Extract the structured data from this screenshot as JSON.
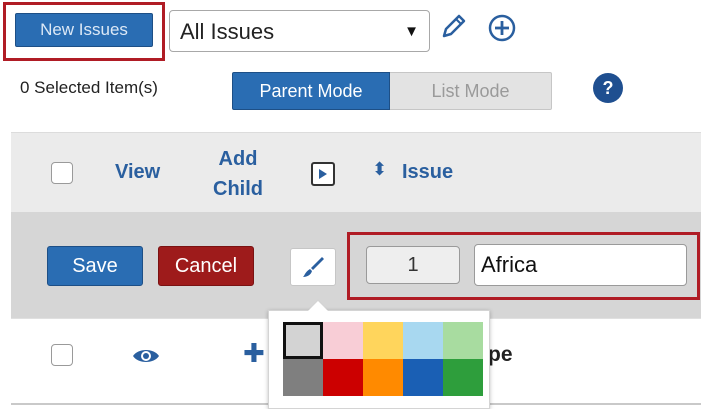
{
  "toolbar": {
    "new_issues_label": "New Issues",
    "view_select_value": "All Issues",
    "edit_icon": "pencil-icon",
    "add_icon": "plus-circle-icon"
  },
  "selection": {
    "count_text": "0  Selected Item(s)",
    "mode_active": "Parent Mode",
    "mode_inactive": "List Mode",
    "help_label": "?"
  },
  "table_header": {
    "view_label": "View",
    "add_child_line1": "Add",
    "add_child_line2": "Child",
    "issue_label": "Issue"
  },
  "edit_row": {
    "save_label": "Save",
    "cancel_label": "Cancel",
    "number_value": "1",
    "issue_name_value": "Africa"
  },
  "data_row": {
    "partial_text": "pe"
  },
  "palette": {
    "colors": [
      "#d3d3d3",
      "#f8cdd6",
      "#ffd55c",
      "#a8d8f0",
      "#a8dca0",
      "#7f7f7f",
      "#cc0000",
      "#ff8a00",
      "#1a5fb4",
      "#2e9e3c"
    ],
    "selected_index": 0
  },
  "colors": {
    "primary": "#2a6db3",
    "danger": "#9e1b1b",
    "highlight": "#b01c25"
  }
}
